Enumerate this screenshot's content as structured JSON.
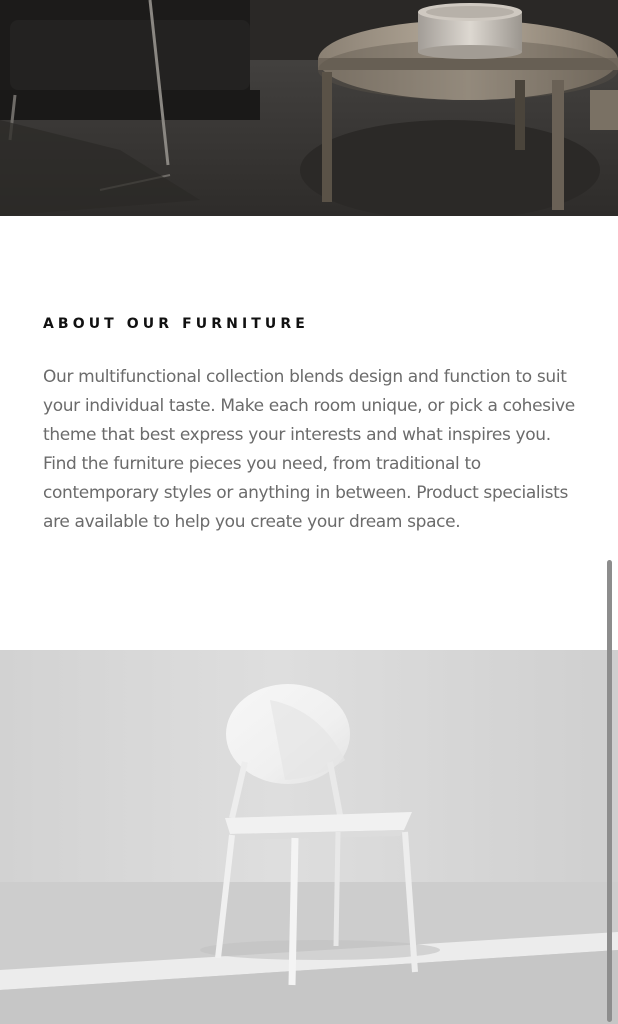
{
  "about": {
    "heading": "ABOUT OUR FURNITURE",
    "body": "Our multifunctional collection blends design and function to suit your individual taste. Make each room unique, or pick a cohesive theme that best express your interests and what inspires you. Find the furniture pieces you need, from traditional to contemporary styles or anything in between. Product specialists are available to help you create your dream space."
  },
  "images": {
    "top": "dark-lounge-armchair-coffee-table-photo",
    "bottom": "white-chair-photo"
  },
  "colors": {
    "heading": "#111111",
    "body_text": "#6b6b6b",
    "top_photo": "#3a3836",
    "bottom_photo": "#d7d7d7",
    "scrollbar": "#8d8d8d"
  }
}
